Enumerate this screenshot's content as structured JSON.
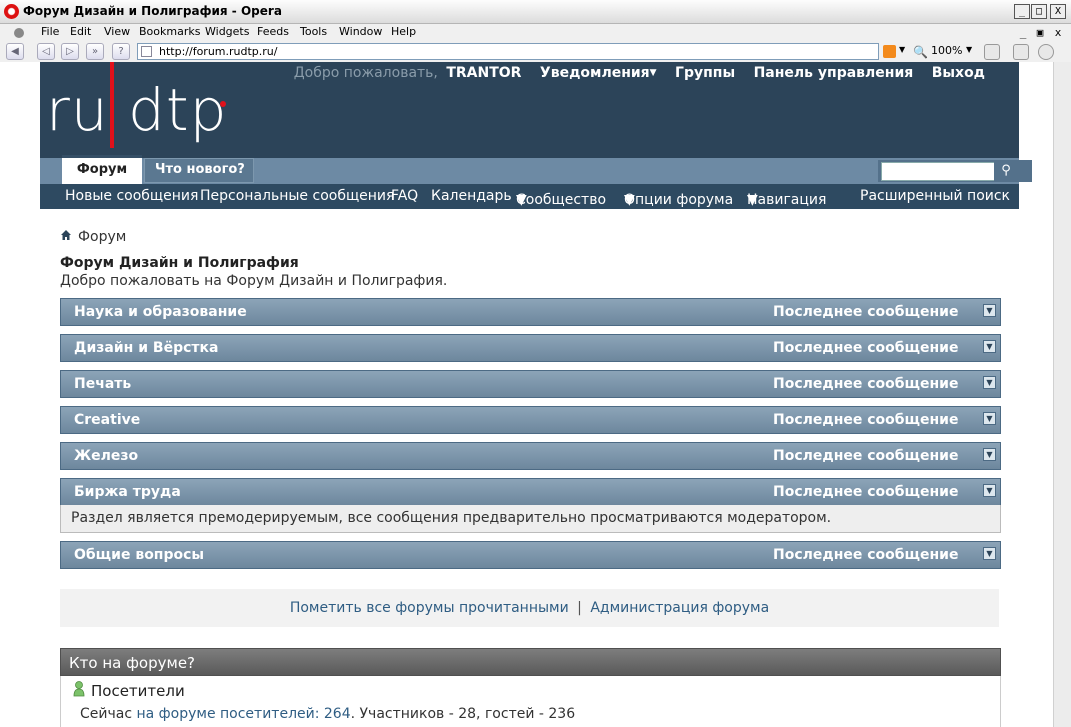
{
  "window": {
    "title": "Форум Дизайн и Полиграфия - Opera",
    "min": "_",
    "max": "□",
    "close": "X",
    "doc_min": "_",
    "doc_restore": "▣",
    "doc_close": "x"
  },
  "menu": [
    "File",
    "Edit",
    "View",
    "Bookmarks",
    "Widgets",
    "Feeds",
    "Tools",
    "Window",
    "Help"
  ],
  "address": {
    "url": "http://forum.rudtp.ru/",
    "zoom": "100%"
  },
  "site": {
    "logo": "ru dtp",
    "welcome": "Добро пожаловать,",
    "username": "TRANTOR",
    "header_links": [
      "Уведомления",
      "Группы",
      "Панель управления",
      "Выход"
    ],
    "tabs": [
      "Форум",
      "Что нового?"
    ],
    "nav_links": [
      "Новые сообщения",
      "Персональные сообщения",
      "FAQ",
      "Календарь",
      "Сообщество",
      "Опции форума",
      "Навигация",
      "Расширенный поиск"
    ]
  },
  "breadcrumb": "Форум",
  "page": {
    "title": "Форум Дизайн и Полиграфия",
    "description": "Добро пожаловать на Форум Дизайн и Полиграфия."
  },
  "last_post_label": "Последнее сообщение",
  "forums": [
    {
      "name": "Наука и образование"
    },
    {
      "name": "Дизайн и Вёрстка"
    },
    {
      "name": "Печать"
    },
    {
      "name": "Creative"
    },
    {
      "name": "Железо"
    },
    {
      "name": "Биржа труда",
      "note": "Раздел является премодерируемым, все сообщения предварительно просматриваются модератором."
    },
    {
      "name": "Общие вопросы"
    }
  ],
  "actions": {
    "mark_read": "Пометить все форумы прочитанными",
    "separator": "|",
    "admin": "Администрация форума"
  },
  "whos_online": {
    "title": "Кто на форуме?",
    "visitors_label": "Посетители",
    "now": "Сейчас",
    "online_link": "на форуме посетителей: 264",
    "rest": ". Участников - 28, гостей - 236"
  },
  "colors": {
    "header_bg": "#2c4459",
    "accent_red": "#e0111b",
    "forum_header": "#7892a8",
    "link": "#2f5d83"
  }
}
